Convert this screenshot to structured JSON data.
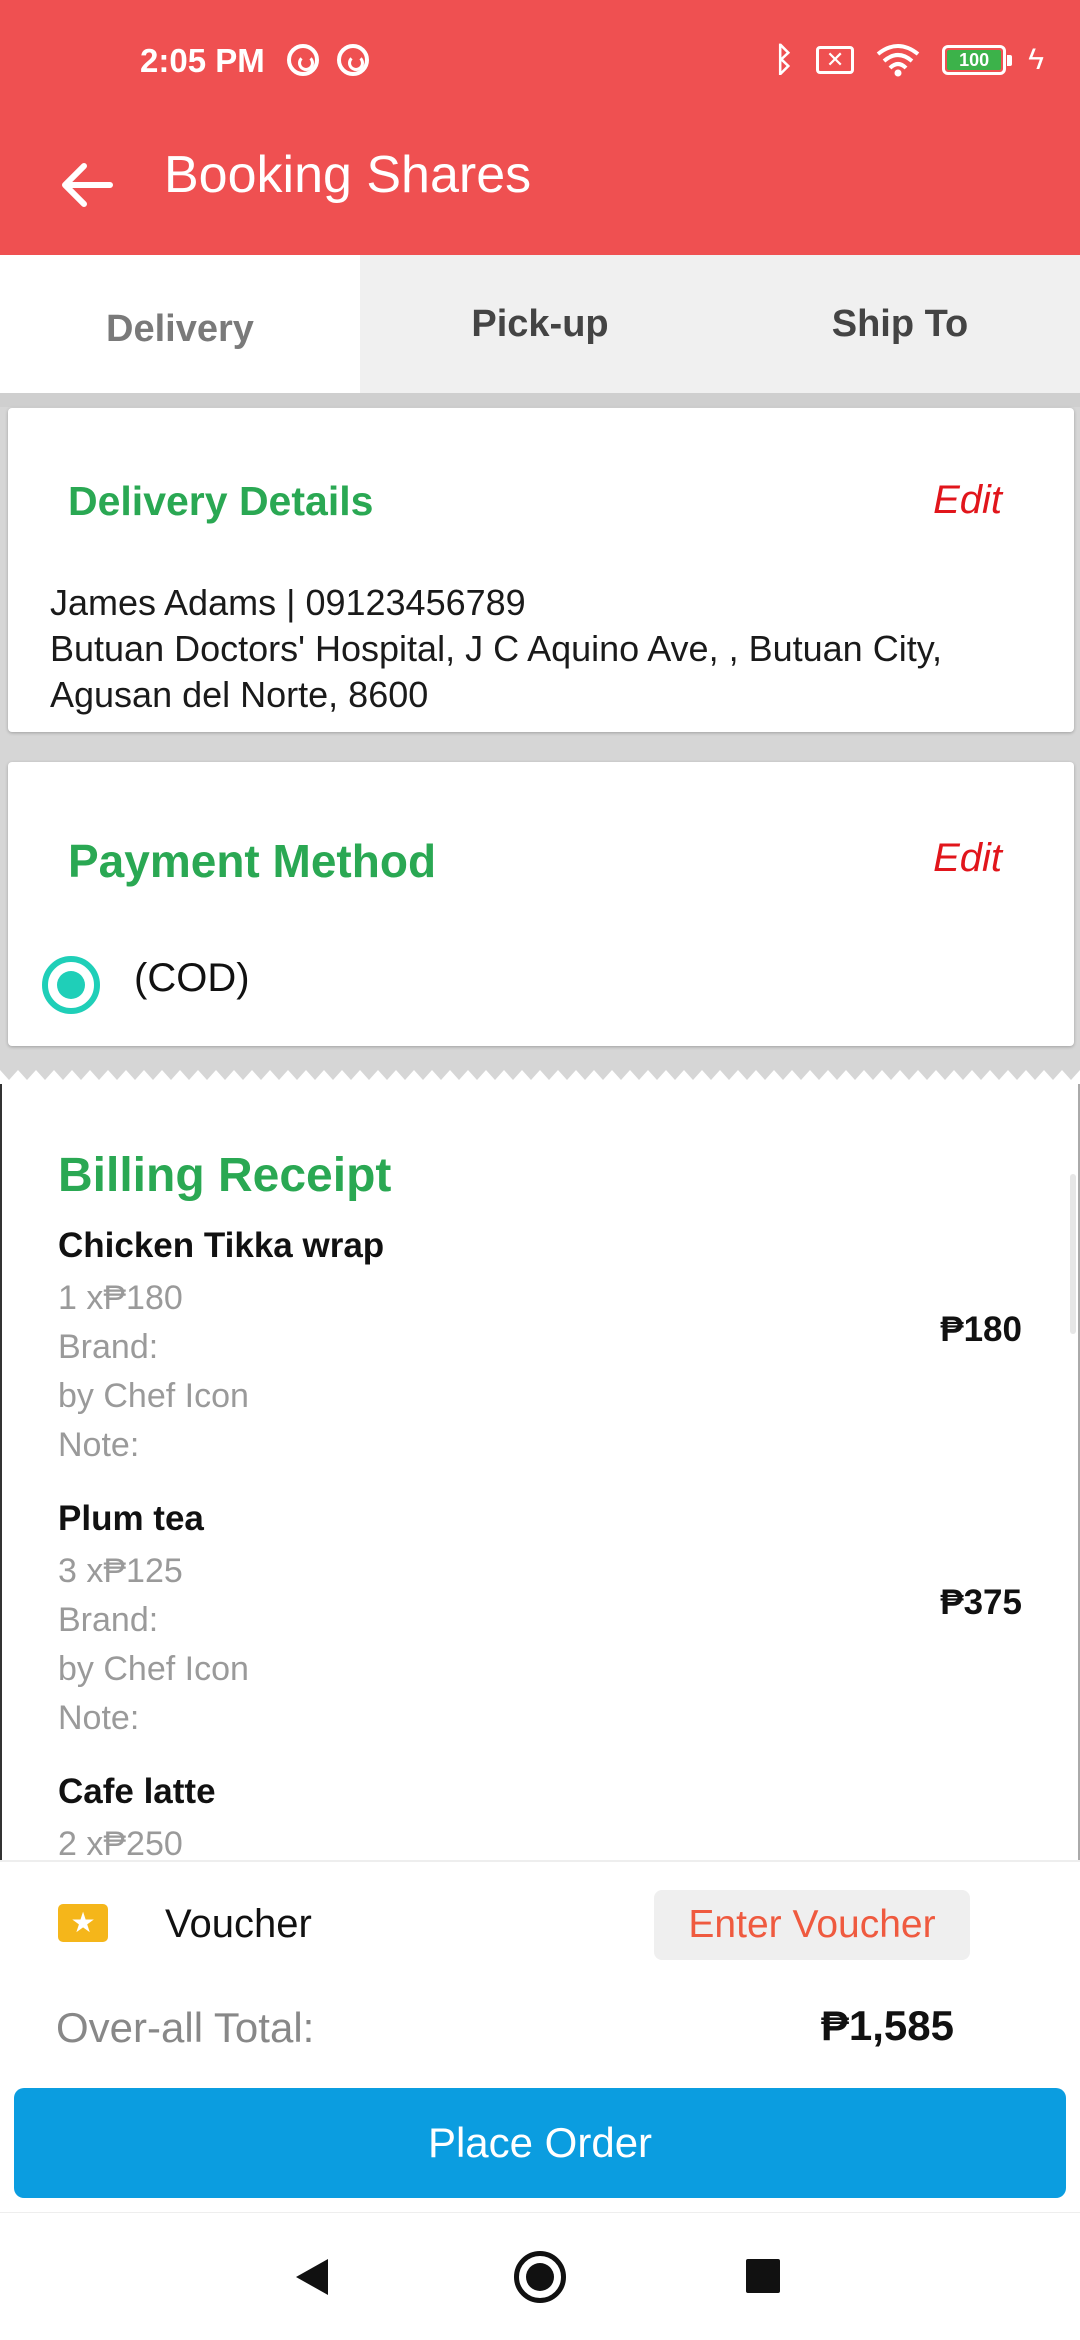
{
  "status_bar": {
    "time": "2:05 PM",
    "battery": "100",
    "icons": [
      "notification-icon",
      "notification-icon",
      "bluetooth-icon",
      "sim-off-icon",
      "wifi-icon",
      "battery-icon",
      "charging-icon"
    ]
  },
  "app_bar": {
    "title": "Booking Shares",
    "back_icon": "arrow-left-icon"
  },
  "tabs": [
    {
      "label": "Delivery",
      "active": true
    },
    {
      "label": "Pick-up",
      "active": false
    },
    {
      "label": "Ship To",
      "active": false
    }
  ],
  "delivery": {
    "title": "Delivery Details",
    "edit_label": "Edit",
    "contact": "James Adams | 09123456789",
    "address_line1": "Butuan Doctors' Hospital,  J C Aquino Ave, , Butuan City,",
    "address_line2": "Agusan del Norte, 8600"
  },
  "payment": {
    "title": "Payment Method",
    "edit_label": "Edit",
    "option": "(COD)",
    "selected": true
  },
  "receipt": {
    "title": "Billing Receipt",
    "items": [
      {
        "name": "Chicken Tikka wrap",
        "qty_price": "1  x₱180",
        "brand_label": "Brand:",
        "brand": "by Chef Icon",
        "note_label": "Note:",
        "total": "₱180"
      },
      {
        "name": "Plum tea",
        "qty_price": "3  x₱125",
        "brand_label": "Brand:",
        "brand": "by Chef Icon",
        "note_label": "Note:",
        "total": "₱375"
      },
      {
        "name": "Cafe latte",
        "qty_price": "2  x₱250"
      }
    ]
  },
  "voucher": {
    "label": "Voucher",
    "button": "Enter Voucher",
    "icon": "ticket-icon"
  },
  "total": {
    "label": "Over-all Total:",
    "value": "₱1,585"
  },
  "place_order": "Place Order",
  "colors": {
    "header": "#ef5051",
    "green": "#2aa853",
    "edit_red": "#e1151b",
    "radio": "#1fcfb8",
    "place_order": "#0b9de0",
    "voucher_text": "#ef5a3f"
  }
}
